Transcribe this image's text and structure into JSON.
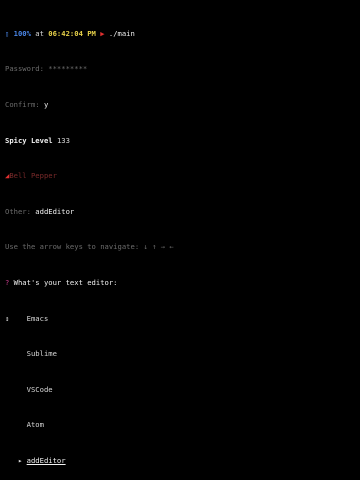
{
  "colors": {
    "background": "#000000",
    "text": "#d8d8d8",
    "dim": "#6c6c6c",
    "battery": "#4a86e8",
    "clock": "#e8d24a",
    "prompt_arrow": "#e03030",
    "faded_red": "#7a2a2a",
    "question_mark": "#c83c8c"
  },
  "status": {
    "battery_icon": "battery-icon",
    "battery_percent": "100%",
    "at_text": "at",
    "time": "06:42:04 PM",
    "prompt_arrow": "▶",
    "command": "./main"
  },
  "form": {
    "password_label": "Password:",
    "password_value": "*********",
    "confirm_label": "Confirm:",
    "confirm_value": "y",
    "spicy_label": "Spicy Level",
    "spicy_value": "133",
    "pepper_icon": "🌶",
    "pepper_text": "Bell Pepper",
    "other_label": "Other:",
    "other_value": "addEditor",
    "nav_hint": "Use the arrow keys to navigate: ↓ ↑ → ←",
    "question_mark": "?",
    "question": "What's your text editor:",
    "indicator": "↕"
  },
  "editors": {
    "options": [
      {
        "label": "Emacs"
      },
      {
        "label": "Sublime"
      },
      {
        "label": "VSCode"
      },
      {
        "label": "Atom"
      },
      {
        "label": "addEditor"
      }
    ],
    "selected_marker": "▸"
  }
}
